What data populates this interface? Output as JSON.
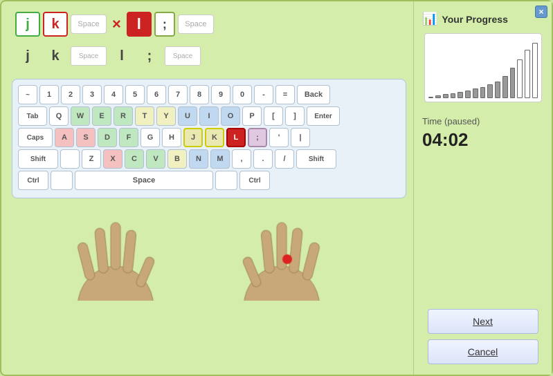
{
  "window": {
    "close_label": "×"
  },
  "target_sequence": [
    {
      "char": "j",
      "type": "correct"
    },
    {
      "char": "k",
      "type": "error"
    },
    {
      "char": "Space",
      "type": "small"
    },
    {
      "cross": true
    },
    {
      "char": "l",
      "type": "active-l"
    },
    {
      "char": ";",
      "type": "semi"
    },
    {
      "char": "Space",
      "type": "small-right"
    }
  ],
  "typed_sequence": [
    {
      "char": "j",
      "type": "plain"
    },
    {
      "char": "k",
      "type": "plain"
    },
    {
      "char": "Space",
      "type": "space"
    },
    {
      "char": "l",
      "type": "plain"
    },
    {
      "char": ";",
      "type": "plain"
    },
    {
      "char": "Space",
      "type": "space"
    }
  ],
  "progress": {
    "title": "Your Progress",
    "bars": [
      3,
      5,
      7,
      9,
      11,
      14,
      17,
      20,
      25,
      30,
      40,
      55,
      70,
      88,
      100
    ],
    "timer_label": "Time (paused)",
    "timer_value": "04:02"
  },
  "buttons": {
    "next_label": "Next",
    "cancel_label": "Cancel"
  },
  "keyboard": {
    "rows": [
      [
        "~",
        "1",
        "2",
        "3",
        "4",
        "5",
        "6",
        "7",
        "8",
        "9",
        "0",
        "-",
        "=",
        "Back"
      ],
      [
        "Tab",
        "Q",
        "W",
        "E",
        "R",
        "T",
        "Y",
        "U",
        "I",
        "O",
        "P",
        "[",
        "]",
        "Enter"
      ],
      [
        "Caps",
        "A",
        "S",
        "D",
        "F",
        "G",
        "H",
        "J",
        "K",
        "L",
        ";",
        "'",
        ""
      ],
      [
        "Shift",
        "",
        "Z",
        "X",
        "C",
        "V",
        "B",
        "N",
        "M",
        ",",
        ".",
        "/",
        "Shift"
      ],
      [
        "Ctrl",
        "",
        "Space",
        "",
        "Ctrl"
      ]
    ]
  }
}
